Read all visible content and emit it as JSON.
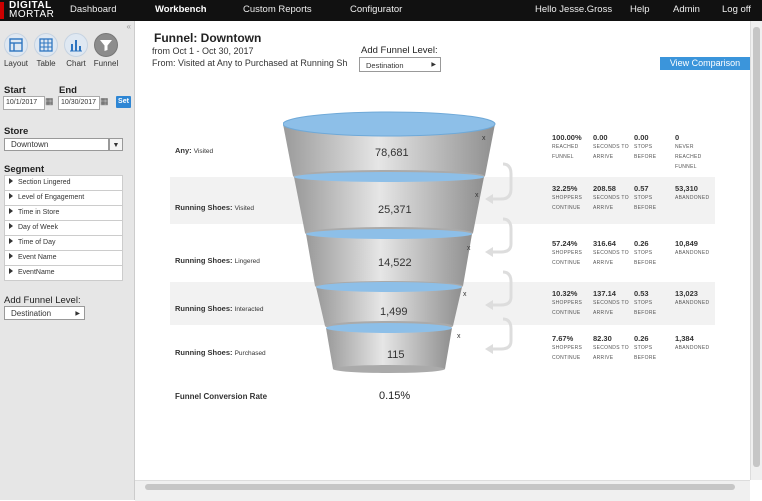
{
  "brand": {
    "line1": "DIGITAL",
    "line2": "MORTAR"
  },
  "nav": {
    "items": [
      "Dashboard",
      "Workbench",
      "Custom Reports",
      "Configurator"
    ],
    "active": "Workbench",
    "user": "Hello Jesse.Gross",
    "help": "Help",
    "admin": "Admin",
    "logoff": "Log off"
  },
  "sidebar": {
    "collapse": "«",
    "views": [
      {
        "label": "Layout",
        "icon": "layout-icon"
      },
      {
        "label": "Table",
        "icon": "table-icon"
      },
      {
        "label": "Chart",
        "icon": "chart-icon"
      },
      {
        "label": "Funnel",
        "icon": "funnel-icon"
      }
    ],
    "start_label": "Start",
    "end_label": "End",
    "start_value": "10/1/2017",
    "end_value": "10/30/2017",
    "set_label": "Set",
    "store_label": "Store",
    "store_value": "Downtown",
    "segment_label": "Segment",
    "segments": [
      "Section Lingered",
      "Level of Engagement",
      "Time in Store",
      "Day of Week",
      "Time of Day",
      "Event Name",
      "EventName"
    ],
    "add_funnel_label": "Add Funnel Level:",
    "add_funnel_value": "Destination"
  },
  "main": {
    "title": "Funnel: Downtown",
    "date_range": "from Oct 1 - Oct 30, 2017",
    "path": "From: Visited at Any to Purchased at Running Sh",
    "add_funnel_label": "Add Funnel Level:",
    "add_funnel_value": "Destination",
    "view_comparison": "View Comparison",
    "conversion_label": "Funnel Conversion Rate",
    "conversion_value": "0.15%",
    "remove_glyph": "x"
  },
  "funnel": {
    "levels": [
      {
        "name": "Any:",
        "action": "Visited",
        "count": "78,681",
        "stats": [
          [
            "100.00%",
            "REACHED FUNNEL"
          ],
          [
            "0.00",
            "SECONDS TO ARRIVE"
          ],
          [
            "0.00",
            "STOPS BEFORE"
          ],
          [
            "0",
            "NEVER REACHED FUNNEL"
          ]
        ]
      },
      {
        "name": "Running Shoes:",
        "action": "Visited",
        "count": "25,371",
        "stats": [
          [
            "32.25%",
            "SHOPPERS CONTINUE"
          ],
          [
            "208.58",
            "SECONDS TO ARRIVE"
          ],
          [
            "0.57",
            "STOPS BEFORE"
          ],
          [
            "53,310",
            "ABANDONED"
          ]
        ]
      },
      {
        "name": "Running Shoes:",
        "action": "Lingered",
        "count": "14,522",
        "stats": [
          [
            "57.24%",
            "SHOPPERS CONTINUE"
          ],
          [
            "316.64",
            "SECONDS TO ARRIVE"
          ],
          [
            "0.26",
            "STOPS BEFORE"
          ],
          [
            "10,849",
            "ABANDONED"
          ]
        ]
      },
      {
        "name": "Running Shoes:",
        "action": "Interacted",
        "count": "1,499",
        "stats": [
          [
            "10.32%",
            "SHOPPERS CONTINUE"
          ],
          [
            "137.14",
            "SECONDS TO ARRIVE"
          ],
          [
            "0.53",
            "STOPS BEFORE"
          ],
          [
            "13,023",
            "ABANDONED"
          ]
        ]
      },
      {
        "name": "Running Shoes:",
        "action": "Purchased",
        "count": "115",
        "stats": [
          [
            "7.67%",
            "SHOPPERS CONTINUE"
          ],
          [
            "82.30",
            "SECONDS TO ARRIVE"
          ],
          [
            "0.26",
            "STOPS BEFORE"
          ],
          [
            "1,384",
            "ABANDONED"
          ]
        ]
      }
    ]
  },
  "colors": {
    "nav_bg": "#111111",
    "accent": "#3b95db",
    "funnel_top": "#8dbfe8",
    "brand_red": "#cc0000"
  }
}
